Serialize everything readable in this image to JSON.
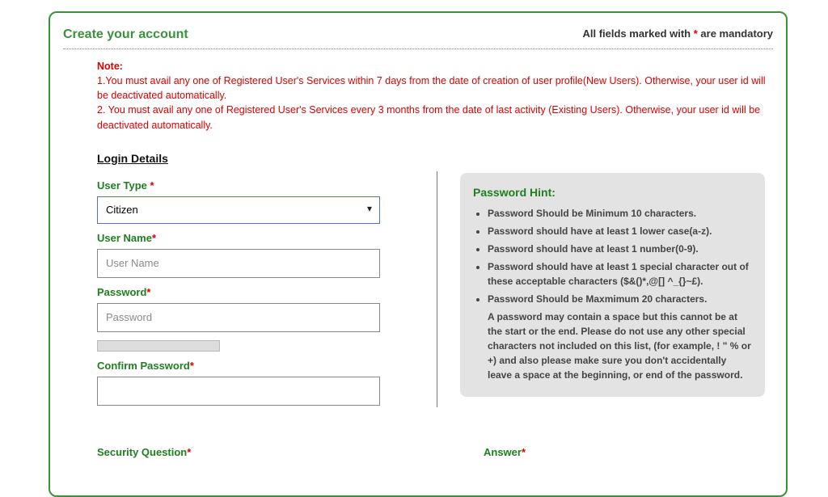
{
  "header": {
    "title": "Create your account",
    "mandatory_prefix": "All fields marked with ",
    "mandatory_star": "*",
    "mandatory_suffix": " are mandatory"
  },
  "note": {
    "heading": "Note:",
    "line1": "1.You must avail any one of Registered User's Services within 7 days from the date of creation of user profile(New Users). Otherwise, your user id will be deactivated automatically.",
    "line2": "2. You must avail any one of Registered User's Services every 3 months from the date of last activity (Existing Users). Otherwise, your user id will be deactivated automatically."
  },
  "section_login_details": "Login Details",
  "fields": {
    "user_type": {
      "label": "User Type ",
      "selected": "Citizen"
    },
    "user_name": {
      "label": "User Name",
      "placeholder": "User Name"
    },
    "password": {
      "label": "Password",
      "placeholder": "Password"
    },
    "confirm_password": {
      "label": "Confirm Password"
    },
    "security_question": {
      "label": "Security Question"
    },
    "answer": {
      "label": "Answer"
    }
  },
  "password_hint": {
    "title": "Password Hint:",
    "items": [
      "Password Should be Minimum 10 characters.",
      "Password should have at least 1 lower case(a-z).",
      "Password should have at least 1 number(0-9).",
      "Password should have at least 1 special character out of these acceptable characters ($&()*,@[] ^_{}~£).",
      "Password Should be Maxmimum 20 characters."
    ],
    "extra": "A password may contain a space but this cannot be at the start or the end. Please do not use any other special characters not included on this list, (for example, ! \" % or +) and also please make sure you don't accidentally leave a space at the beginning, or end of the password."
  }
}
